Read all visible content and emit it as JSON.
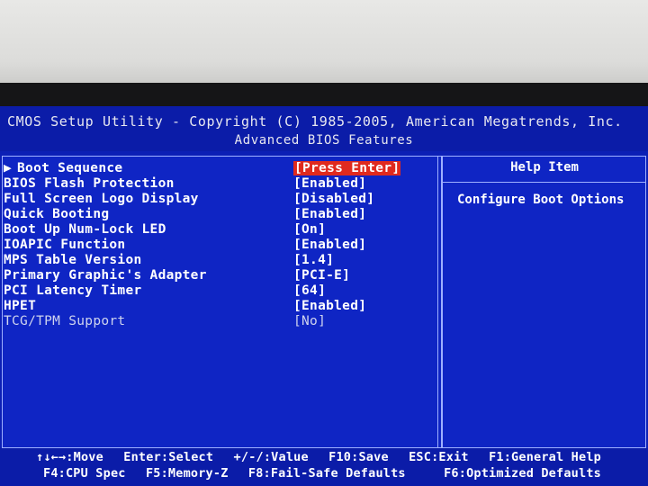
{
  "header": {
    "title": "CMOS Setup Utility - Copyright (C) 1985-2005, American Megatrends, Inc.",
    "subtitle": "Advanced BIOS Features"
  },
  "settings": [
    {
      "label": "Boot Sequence",
      "value": "[Press Enter]",
      "selected": true,
      "submenu": true
    },
    {
      "label": "BIOS Flash Protection",
      "value": "[Enabled]"
    },
    {
      "label": "Full Screen Logo Display",
      "value": "[Disabled]"
    },
    {
      "label": "Quick Booting",
      "value": "[Enabled]"
    },
    {
      "label": "Boot Up Num-Lock LED",
      "value": "[On]"
    },
    {
      "label": "IOAPIC Function",
      "value": "[Enabled]"
    },
    {
      "label": "MPS Table Version",
      "value": "[1.4]"
    },
    {
      "label": "Primary Graphic's Adapter",
      "value": "[PCI-E]"
    },
    {
      "label": "PCI Latency Timer",
      "value": "[64]"
    },
    {
      "label": "HPET",
      "value": "[Enabled]"
    },
    {
      "label": "TCG/TPM Support",
      "value": "[No]",
      "dim": true
    }
  ],
  "help": {
    "title": "Help Item",
    "text": "Configure Boot Options"
  },
  "footer": {
    "line1": [
      "↑↓←→:Move",
      "Enter:Select",
      "+/-/:Value",
      "F10:Save",
      "ESC:Exit",
      "F1:General Help"
    ],
    "line2": [
      "F4:CPU Spec",
      "F5:Memory-Z",
      "F8:Fail-Safe Defaults",
      "F6:Optimized Defaults"
    ]
  },
  "colors": {
    "background": "#0c1fb5",
    "highlight": "#e02a1e",
    "text": "#ffffff"
  },
  "icons": {
    "submenu": "triangle-right-icon"
  }
}
